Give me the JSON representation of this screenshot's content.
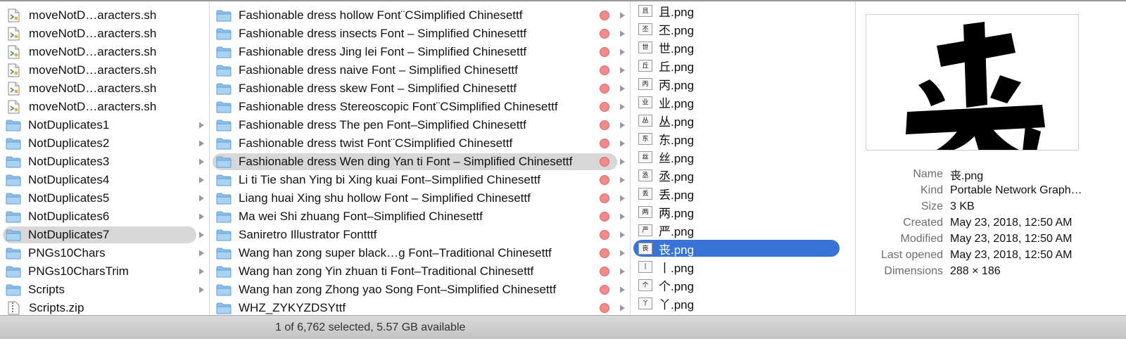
{
  "column1": {
    "items": [
      {
        "label": "moveNotD…aracters.sh",
        "kind": "script"
      },
      {
        "label": "moveNotD…aracters.sh",
        "kind": "script"
      },
      {
        "label": "moveNotD…aracters.sh",
        "kind": "script"
      },
      {
        "label": "moveNotD…aracters.sh",
        "kind": "script"
      },
      {
        "label": "moveNotD…aracters.sh",
        "kind": "script"
      },
      {
        "label": "moveNotD…aracters.sh",
        "kind": "script"
      },
      {
        "label": "NotDuplicates1",
        "kind": "folder"
      },
      {
        "label": "NotDuplicates2",
        "kind": "folder"
      },
      {
        "label": "NotDuplicates3",
        "kind": "folder"
      },
      {
        "label": "NotDuplicates4",
        "kind": "folder"
      },
      {
        "label": "NotDuplicates5",
        "kind": "folder"
      },
      {
        "label": "NotDuplicates6",
        "kind": "folder"
      },
      {
        "label": "NotDuplicates7",
        "kind": "folder",
        "selected": true
      },
      {
        "label": "PNGs10Chars",
        "kind": "folder"
      },
      {
        "label": "PNGs10CharsTrim",
        "kind": "folder"
      },
      {
        "label": "Scripts",
        "kind": "folder"
      },
      {
        "label": "Scripts.zip",
        "kind": "zip"
      }
    ]
  },
  "column2": {
    "items": [
      {
        "label": "Fashionable dress hollow Font¨CSimplified Chinesettf"
      },
      {
        "label": "Fashionable dress insects Font – Simplified Chinesettf"
      },
      {
        "label": "Fashionable dress Jing lei Font – Simplified Chinesettf"
      },
      {
        "label": "Fashionable dress naive Font – Simplified Chinesettf"
      },
      {
        "label": "Fashionable dress skew Font – Simplified Chinesettf"
      },
      {
        "label": "Fashionable dress Stereoscopic Font¨CSimplified Chinesettf"
      },
      {
        "label": "Fashionable dress The pen Font–Simplified Chinesettf"
      },
      {
        "label": "Fashionable dress twist Font¨CSimplified Chinesettf"
      },
      {
        "label": "Fashionable dress Wen ding Yan ti Font – Simplified Chinesettf",
        "selected": true
      },
      {
        "label": "Li ti Tie shan Ying bi Xing kuai Font–Simplified Chinesettf"
      },
      {
        "label": "Liang huai Xing shu hollow Font – Simplified Chinesettf"
      },
      {
        "label": "Ma wei Shi zhuang Font–Simplified Chinesettf"
      },
      {
        "label": "Saniretro Illustrator Fontttf"
      },
      {
        "label": "Wang han zong super black…g Font–Traditional Chinesettf"
      },
      {
        "label": "Wang han zong Yin zhuan ti Font–Traditional Chinesettf"
      },
      {
        "label": "Wang han zong Zhong yao Song Font–Simplified Chinesettf"
      },
      {
        "label": "WHZ_ZYKYZDSYttf"
      }
    ],
    "tag_color": "#f28a8a"
  },
  "column3": {
    "items": [
      {
        "label": "且.png",
        "glyph": "且"
      },
      {
        "label": "丕.png",
        "glyph": "丕"
      },
      {
        "label": "世.png",
        "glyph": "世"
      },
      {
        "label": "丘.png",
        "glyph": "丘"
      },
      {
        "label": "丙.png",
        "glyph": "丙"
      },
      {
        "label": "业.png",
        "glyph": "业"
      },
      {
        "label": "丛.png",
        "glyph": "丛"
      },
      {
        "label": "东.png",
        "glyph": "东"
      },
      {
        "label": "丝.png",
        "glyph": "丝"
      },
      {
        "label": "丞.png",
        "glyph": "丞"
      },
      {
        "label": "丢.png",
        "glyph": "丢"
      },
      {
        "label": "两.png",
        "glyph": "两"
      },
      {
        "label": "严.png",
        "glyph": "严"
      },
      {
        "label": "丧.png",
        "glyph": "丧",
        "selected": true
      },
      {
        "label": "丨.png",
        "glyph": "丨"
      },
      {
        "label": "个.png",
        "glyph": "个"
      },
      {
        "label": "丫.png",
        "glyph": "丫"
      }
    ],
    "selection_color": "#3874d8"
  },
  "preview": {
    "glyph": "丧",
    "info": [
      {
        "key": "Name",
        "value": "丧.png"
      },
      {
        "key": "Kind",
        "value": "Portable Network Graph…"
      },
      {
        "key": "Size",
        "value": "3 KB"
      },
      {
        "key": "Created",
        "value": "May 23, 2018, 12:50 AM"
      },
      {
        "key": "Modified",
        "value": "May 23, 2018, 12:50 AM"
      },
      {
        "key": "Last opened",
        "value": "May 23, 2018, 12:50 AM"
      },
      {
        "key": "Dimensions",
        "value": "288 × 186"
      }
    ]
  },
  "status_bar": {
    "text": "1 of 6,762 selected, 5.57 GB available"
  }
}
